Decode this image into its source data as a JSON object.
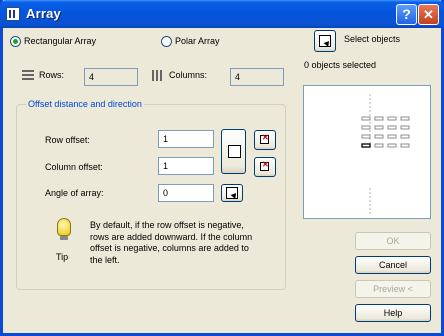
{
  "window": {
    "title": "Array"
  },
  "array_type": {
    "rectangular_label": "Rectangular Array",
    "polar_label": "Polar Array",
    "selected": "rectangular"
  },
  "select_objects": {
    "label": "Select objects",
    "status": "0 objects selected"
  },
  "rows": {
    "label": "Rows:",
    "value": "4"
  },
  "columns": {
    "label": "Columns:",
    "value": "4"
  },
  "offset_group": {
    "title": "Offset distance and direction",
    "row_offset_label": "Row offset:",
    "row_offset_value": "1",
    "column_offset_label": "Column offset:",
    "column_offset_value": "1",
    "angle_label": "Angle of array:",
    "angle_value": "0"
  },
  "tip": {
    "label": "Tip",
    "text": "By default, if the row offset is negative, rows are added downward. If the column offset is negative, columns are added to the left."
  },
  "buttons": {
    "ok": "OK",
    "cancel": "Cancel",
    "preview": "Preview <",
    "help": "Help"
  },
  "icons": {
    "app": "array-app-icon",
    "help": "help-icon",
    "close": "close-icon",
    "select": "select-objects-icon",
    "rows": "rows-icon",
    "columns": "columns-icon",
    "pick_both": "pick-both-offsets-icon",
    "pick_row": "pick-row-offset-icon",
    "pick_col": "pick-column-offset-icon",
    "pick_angle": "pick-angle-icon",
    "tip": "lightbulb-icon"
  },
  "colors": {
    "title_blue": "#0454db",
    "group_title": "#0046d5",
    "dialog_bg": "#ece9d8"
  }
}
